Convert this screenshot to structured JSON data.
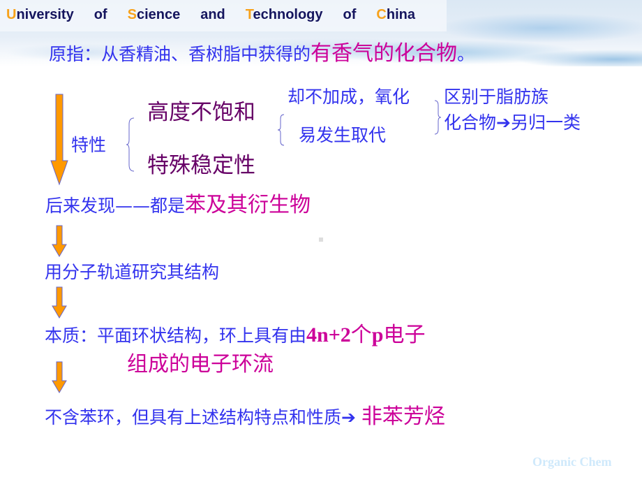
{
  "header": {
    "words": [
      {
        "cap": "U",
        "rest": "niversity"
      },
      {
        "cap": "",
        "rest": "of"
      },
      {
        "cap": "S",
        "rest": "cience"
      },
      {
        "cap": "",
        "rest": "and"
      },
      {
        "cap": "T",
        "rest": "echnology"
      },
      {
        "cap": "",
        "rest": "of"
      },
      {
        "cap": "C",
        "rest": "hina"
      }
    ]
  },
  "colors": {
    "blue_text": "#3333ee",
    "magenta_text": "#cc0099",
    "plum_text": "#660066",
    "header_text": "#15155e",
    "header_caps": "#f7a21c",
    "arrow_fill": "#ff9900",
    "arrow_stroke": "#6666cc"
  },
  "content": {
    "origin": {
      "prefix": "原指：从香精油、香树脂中获得的",
      "highlight": "有香气的化合物",
      "suffix": "。"
    },
    "properties": {
      "label": "特性",
      "item1": "高度不饱和",
      "item2": "特殊稳定性",
      "sub1": "却不加成，氧化",
      "sub2": "易发生取代",
      "conclusion_line1": "区别于脂肪族",
      "conclusion_line2_prefix": "化合物",
      "conclusion_arrow": "➔",
      "conclusion_line2_suffix": "另归一类"
    },
    "discovery": {
      "prefix": "后来发现——都是",
      "highlight": "苯及其衍生物"
    },
    "study": "用分子轨道研究其结构",
    "essence": {
      "prefix": "本质：平面环状结构，环上具有由",
      "formula": "4n+2",
      "ge": "个",
      "p": "p",
      "suffix1": "电子",
      "line2": "组成的电子环流"
    },
    "nonbenzenoid": {
      "prefix": "不含苯环，但具有上述结构特点和性质",
      "arrow": "➔",
      "highlight": "非苯芳烃"
    }
  },
  "footer": {
    "watermark": "Organic Chem"
  }
}
